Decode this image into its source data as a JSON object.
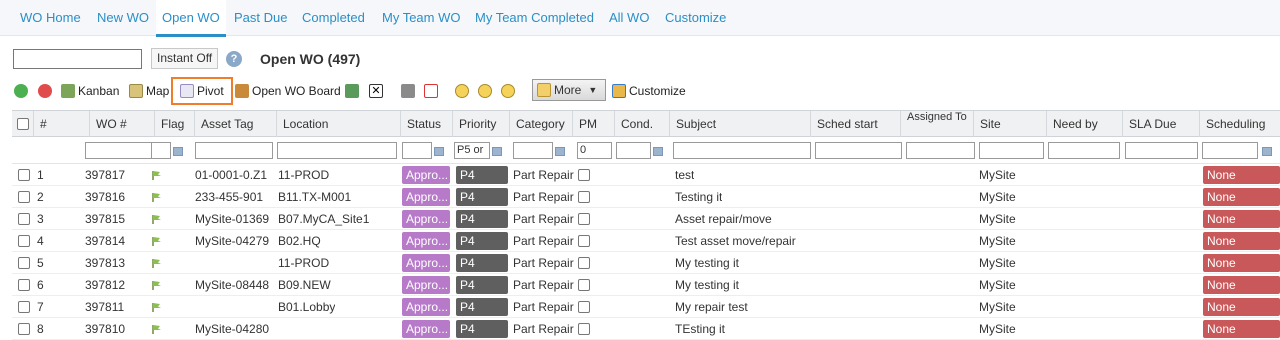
{
  "tabs": [
    {
      "label": "WO Home"
    },
    {
      "label": "New WO"
    },
    {
      "label": "Open WO"
    },
    {
      "label": "Past Due"
    },
    {
      "label": "Completed"
    },
    {
      "label": "My Team WO"
    },
    {
      "label": "My Team Completed"
    },
    {
      "label": "All WO"
    },
    {
      "label": "Customize"
    }
  ],
  "search": {
    "value": "",
    "instant_label": "Instant Off",
    "help_icon": "?"
  },
  "list_title": "Open WO (497)",
  "toolbar": {
    "kanban": "Kanban",
    "map": "Map",
    "pivot": "Pivot",
    "open_board": "Open WO Board",
    "more": "More",
    "customize": "Customize"
  },
  "columns": [
    "#",
    "WO #",
    "Flag",
    "Asset Tag",
    "Location",
    "Status",
    "Priority",
    "Category",
    "PM",
    "Cond.",
    "Subject",
    "Sched start",
    "Assigned To",
    "Site",
    "Need by",
    "SLA Due",
    "Scheduling"
  ],
  "filters": {
    "priority": "P5 or",
    "pm": "0"
  },
  "rows": [
    {
      "num": "1",
      "wo": "397817",
      "asset": "01-0001-0.Z1",
      "location": "11-PROD",
      "status": "Appro...",
      "priority": "P4",
      "category": "Part Repair",
      "subject": "test",
      "site": "MySite",
      "scheduling": "None"
    },
    {
      "num": "2",
      "wo": "397816",
      "asset": "233-455-901",
      "location": "B11.TX-M001",
      "status": "Appro...",
      "priority": "P4",
      "category": "Part Repair",
      "subject": "Testing it",
      "site": "MySite",
      "scheduling": "None"
    },
    {
      "num": "3",
      "wo": "397815",
      "asset": "MySite-01369",
      "location": "B07.MyCA_Site1",
      "status": "Appro...",
      "priority": "P4",
      "category": "Part Repair",
      "subject": "Asset repair/move",
      "site": "MySite",
      "scheduling": "None"
    },
    {
      "num": "4",
      "wo": "397814",
      "asset": "MySite-04279",
      "location": "B02.HQ",
      "status": "Appro...",
      "priority": "P4",
      "category": "Part Repair",
      "subject": "Test asset move/repair",
      "site": "MySite",
      "scheduling": "None"
    },
    {
      "num": "5",
      "wo": "397813",
      "asset": "",
      "location": "11-PROD",
      "status": "Appro...",
      "priority": "P4",
      "category": "Part Repair",
      "subject": "My testing it",
      "site": "MySite",
      "scheduling": "None"
    },
    {
      "num": "6",
      "wo": "397812",
      "asset": "MySite-08448",
      "location": "B09.NEW",
      "status": "Appro...",
      "priority": "P4",
      "category": "Part Repair",
      "subject": "My testing it",
      "site": "MySite",
      "scheduling": "None"
    },
    {
      "num": "7",
      "wo": "397811",
      "asset": "",
      "location": "B01.Lobby",
      "status": "Appro...",
      "priority": "P4",
      "category": "Part Repair",
      "subject": "My repair test",
      "site": "MySite",
      "scheduling": "None"
    },
    {
      "num": "8",
      "wo": "397810",
      "asset": "MySite-04280",
      "location": "",
      "status": "Appro...",
      "priority": "P4",
      "category": "Part Repair",
      "subject": "TEsting it",
      "site": "MySite",
      "scheduling": "None"
    }
  ],
  "colors": {
    "accent": "#2a8fc7",
    "status": "#b77ac9",
    "priority": "#5f5f5f",
    "scheduling": "#c9585a",
    "highlight": "#f07d2a"
  }
}
